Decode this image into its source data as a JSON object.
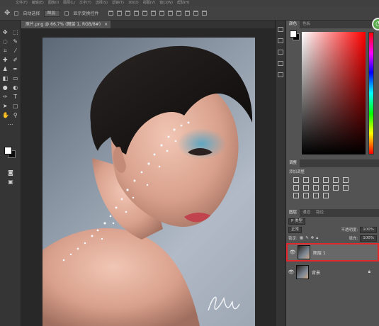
{
  "menu": [
    "文件(F)",
    "编辑(E)",
    "图像(I)",
    "图层(L)",
    "文字(Y)",
    "选择(S)",
    "滤镜(T)",
    "3D(D)",
    "视图(V)",
    "窗口(W)",
    "帮助(H)"
  ],
  "options_bar": {
    "auto_select_label": "自动选择",
    "target_value": "图层",
    "transform_label": "显示变换控件"
  },
  "document": {
    "tab_title": "原片.png @ 66.7% (图层 1, RGB/8#)",
    "close_glyph": "×"
  },
  "color_panel": {
    "tabs": [
      "颜色",
      "色板"
    ],
    "foreground": "#ffffff",
    "background": "#000000"
  },
  "adjustments_panel": {
    "tabs": [
      "调整"
    ],
    "title": "添加调整"
  },
  "layers_panel": {
    "tabs": [
      "图层",
      "通道",
      "路径"
    ],
    "kind_filter": "P 类型",
    "blend_mode": "正常",
    "opacity_label": "不透明度:",
    "opacity_value": "100%",
    "lock_label": "锁定:",
    "fill_label": "填充:",
    "fill_value": "100%",
    "layers": [
      {
        "name": "图层 1",
        "visible": true,
        "selected": true,
        "highlight_color": "#e0282d"
      },
      {
        "name": "背景",
        "visible": true,
        "selected": false,
        "locked": true
      }
    ]
  },
  "artwork": {
    "signature_text": "yu"
  }
}
